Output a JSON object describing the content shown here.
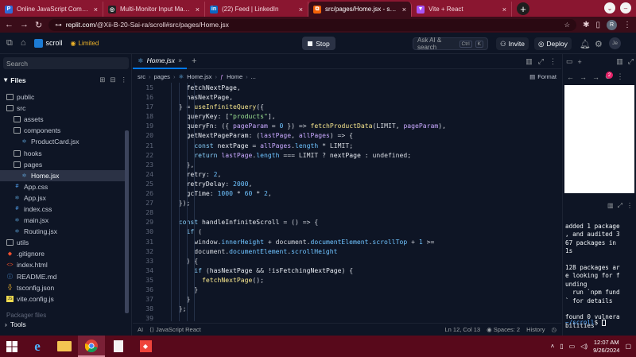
{
  "browser": {
    "tabs": [
      {
        "title": "Online JavaScript Compiler (Ed",
        "icon": "js-compiler-icon",
        "active": false
      },
      {
        "title": "Multi-Monitor Input Managem",
        "icon": "chatgpt-icon",
        "active": false
      },
      {
        "title": "(22) Feed | LinkedIn",
        "icon": "linkedin-icon",
        "active": false
      },
      {
        "title": "src/pages/Home.jsx - scroll - R",
        "icon": "replit-icon",
        "active": true
      },
      {
        "title": "Vite + React",
        "icon": "vite-icon",
        "active": false
      }
    ],
    "url_host": "replit.com",
    "url_path": "/@Xii-B-20-Sai-ra/scroll#src/pages/Home.jsx",
    "profile_initial": "R"
  },
  "replit": {
    "project_name": "scroll",
    "plan_badge": "Limited",
    "stop_label": "Stop",
    "ask_ai_placeholder": "Ask AI & search",
    "ask_ai_shortcut_1": "Ctrl",
    "ask_ai_shortcut_2": "K",
    "invite_label": "Invite",
    "deploy_label": "Deploy",
    "avatar_label": "Je"
  },
  "sidebar": {
    "search_placeholder": "Search",
    "files_header": "Files",
    "tree": [
      {
        "label": "public",
        "type": "folder",
        "depth": 0
      },
      {
        "label": "src",
        "type": "folder",
        "depth": 0
      },
      {
        "label": "assets",
        "type": "folder",
        "depth": 1
      },
      {
        "label": "components",
        "type": "folder",
        "depth": 1
      },
      {
        "label": "ProductCard.jsx",
        "type": "jsx",
        "depth": 2
      },
      {
        "label": "hooks",
        "type": "folder",
        "depth": 1
      },
      {
        "label": "pages",
        "type": "folder",
        "depth": 1
      },
      {
        "label": "Home.jsx",
        "type": "jsx",
        "depth": 2,
        "selected": true
      },
      {
        "label": "App.css",
        "type": "css",
        "depth": 1
      },
      {
        "label": "App.jsx",
        "type": "jsx",
        "depth": 1
      },
      {
        "label": "index.css",
        "type": "css",
        "depth": 1
      },
      {
        "label": "main.jsx",
        "type": "jsx",
        "depth": 1
      },
      {
        "label": "Routing.jsx",
        "type": "jsx",
        "depth": 1
      },
      {
        "label": "utils",
        "type": "folder",
        "depth": 0
      },
      {
        "label": ".gitignore",
        "type": "git",
        "depth": 0
      },
      {
        "label": "index.html",
        "type": "html",
        "depth": 0
      },
      {
        "label": "README.md",
        "type": "md",
        "depth": 0
      },
      {
        "label": "tsconfig.json",
        "type": "json",
        "depth": 0
      },
      {
        "label": "vite.config.js",
        "type": "js",
        "depth": 0
      }
    ],
    "packager_label": "Packager files",
    "tools_label": "Tools"
  },
  "editor": {
    "tab_label": "Home.jsx",
    "breadcrumb": [
      "src",
      "pages",
      "Home.jsx",
      "Home",
      "..."
    ],
    "format_label": "Format",
    "lines": [
      {
        "n": "15",
        "indent": 2,
        "html": "<span class='vr'>fetchNextPage</span>,"
      },
      {
        "n": "16",
        "indent": 2,
        "html": "<span class='vr'>hasNextPage</span>,"
      },
      {
        "n": "17",
        "indent": 1,
        "html": "} = <span class='fn'>useInfiniteQuery</span>({"
      },
      {
        "n": "18",
        "indent": 2,
        "html": "<span class='vr'>queryKey</span>: [<span class='st'>\"products\"</span>],"
      },
      {
        "n": "19",
        "indent": 2,
        "html": "<span class='vr'>queryFn</span>: ({ <span class='pr'>pageParam</span> = <span class='nm'>0</span> }) => <span class='fn'>fetchProductData</span>(LIMIT, <span class='pr'>pageParam</span>),"
      },
      {
        "n": "20",
        "indent": 2,
        "html": "<span class='vr'>getNextPageParam</span>: (<span class='pr'>lastPage</span>, <span class='pr'>allPages</span>) => {"
      },
      {
        "n": "21",
        "indent": 3,
        "html": "<span class='kw'>const</span> <span class='vr'>nextPage</span> = <span class='pr'>allPages</span>.<span class='nm'>length</span> * LIMIT;"
      },
      {
        "n": "22",
        "indent": 3,
        "html": "<span class='kw'>return</span> <span class='pr'>lastPage</span>.<span class='nm'>length</span> === LIMIT ? <span class='vr'>nextPage</span> : undefined;"
      },
      {
        "n": "23",
        "indent": 2,
        "html": "},"
      },
      {
        "n": "24",
        "indent": 2,
        "html": "<span class='vr'>retry</span>: <span class='nm'>2</span>,"
      },
      {
        "n": "25",
        "indent": 2,
        "html": "<span class='vr'>retryDelay</span>: <span class='nm'>2000</span>,"
      },
      {
        "n": "26",
        "indent": 2,
        "html": "<span class='vr'>gcTime</span>: <span class='nm'>1000</span> * <span class='nm'>60</span> * <span class='nm'>2</span>,"
      },
      {
        "n": "27",
        "indent": 1,
        "html": "});"
      },
      {
        "n": "28",
        "indent": 0,
        "html": ""
      },
      {
        "n": "29",
        "indent": 1,
        "html": "<span class='kw'>const</span> <span class='vr'>handleInfiniteScroll</span> = () => {"
      },
      {
        "n": "30",
        "indent": 2,
        "html": "<span class='kw'>if</span> ("
      },
      {
        "n": "31",
        "indent": 3,
        "html": "window.<span class='nm'>innerHeight</span> + document.<span class='nm'>documentElement</span>.<span class='nm'>scrollTop</span> + <span class='nm'>1</span> >="
      },
      {
        "n": "32",
        "indent": 3,
        "html": "document.<span class='nm'>documentElement</span>.<span class='nm'>scrollHeight</span>"
      },
      {
        "n": "33",
        "indent": 2,
        "html": ") {"
      },
      {
        "n": "34",
        "indent": 3,
        "html": "<span class='kw'>if</span> (<span class='vr'>hasNextPage</span> && !<span class='vr'>isFetchingNextPage</span>) {"
      },
      {
        "n": "35",
        "indent": 4,
        "html": "<span class='fn'>fetchNextPage</span>();"
      },
      {
        "n": "36",
        "indent": 3,
        "html": "}"
      },
      {
        "n": "37",
        "indent": 2,
        "html": "}"
      },
      {
        "n": "38",
        "indent": 1,
        "html": "};"
      },
      {
        "n": "39",
        "indent": 0,
        "html": ""
      }
    ],
    "status_ai": "AI",
    "status_lang": "JavaScript React",
    "status_pos": "Ln 12, Col 13",
    "status_spaces": "Spaces: 2",
    "status_history": "History"
  },
  "webview": {
    "badge_count": "2"
  },
  "console": {
    "output": "added 1 package\n, and audited 3\n67 packages in\n1s\n\n128 packages ar\ne looking for f\nunding\n  run `npm fund\n` for details\n\nfound 0 vulnera\nbilities",
    "prompt_path": "~/scroll",
    "prompt_symbol": "$"
  },
  "taskbar": {
    "time": "12:07 AM",
    "date": "9/26/2024"
  },
  "colors": {
    "accent": "#0079f2",
    "browser_frame": "#8a1630",
    "taskbar": "#58091b"
  }
}
